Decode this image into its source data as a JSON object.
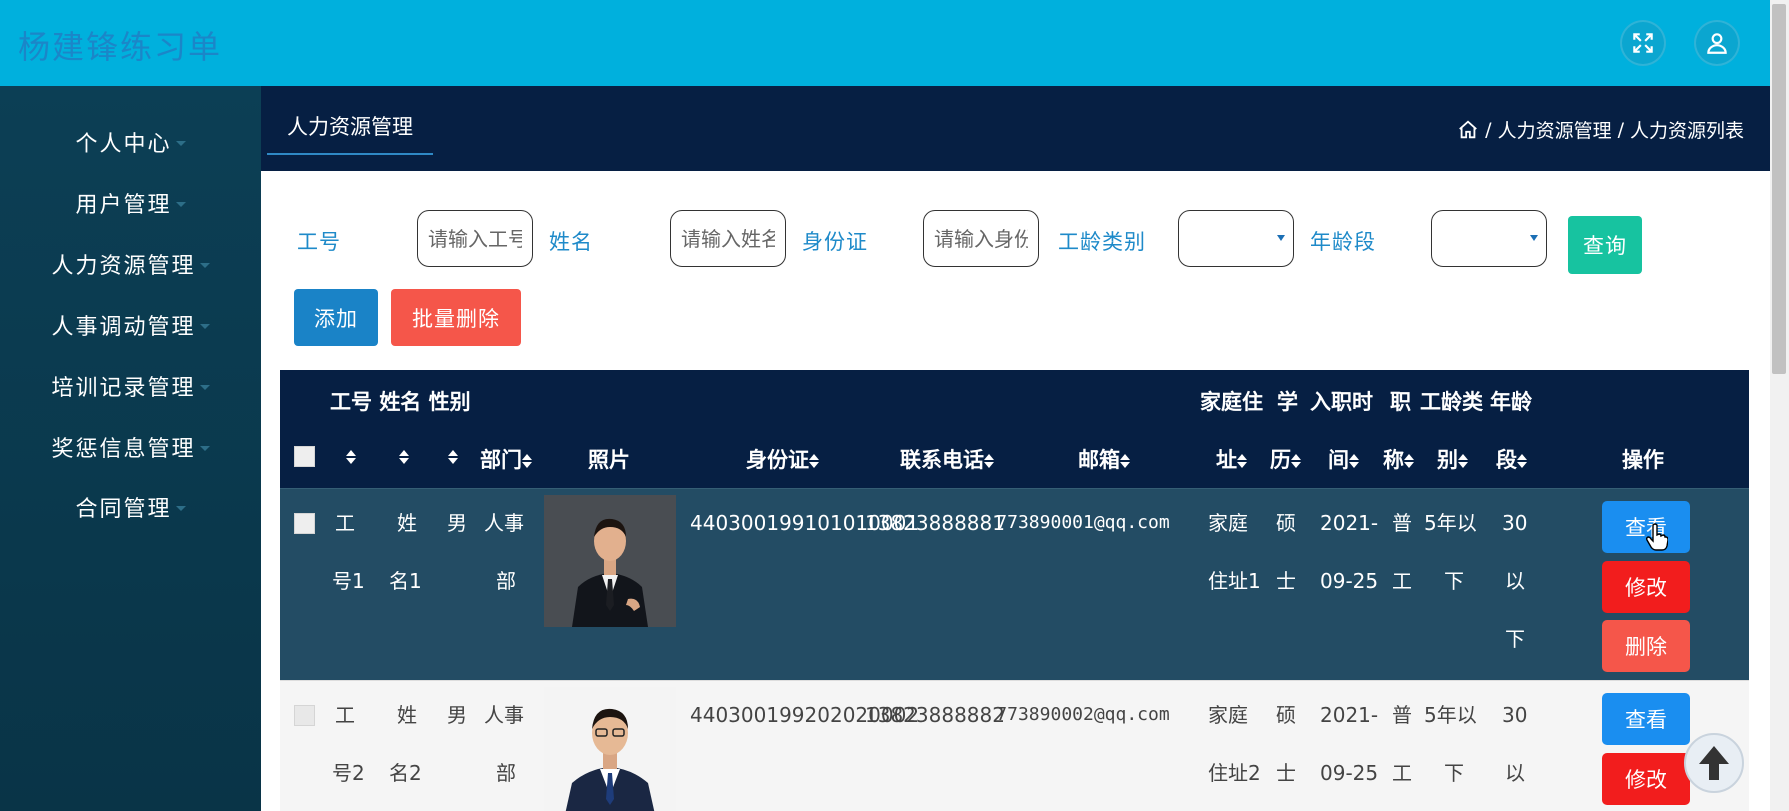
{
  "app": {
    "title": "杨建锋练习单"
  },
  "header": {
    "fullscreen_icon": "expand-arrows-icon",
    "user_icon": "user-icon"
  },
  "sidebar": {
    "items": [
      {
        "label": "个人中心"
      },
      {
        "label": "用户管理"
      },
      {
        "label": "人力资源管理"
      },
      {
        "label": "人事调动管理"
      },
      {
        "label": "培训记录管理"
      },
      {
        "label": "奖惩信息管理"
      },
      {
        "label": "合同管理"
      }
    ]
  },
  "tabs": {
    "active": "人力资源管理"
  },
  "breadcrumb": {
    "home_icon": "home-icon",
    "sep": "/",
    "level1": "人力资源管理",
    "level2": "人力资源列表"
  },
  "filters": {
    "gonghao": {
      "label": "工号",
      "placeholder": "请输入工号"
    },
    "xingming": {
      "label": "姓名",
      "placeholder": "请输入姓名"
    },
    "shenfenzheng": {
      "label": "身份证",
      "placeholder": "请输入身份证"
    },
    "gonglingleibie": {
      "label": "工龄类别",
      "value": ""
    },
    "nianlingduan": {
      "label": "年龄段",
      "value": ""
    },
    "query_label": "查询"
  },
  "toolbar": {
    "add_label": "添加",
    "batch_delete_label": "批量删除"
  },
  "table": {
    "columns": {
      "gonghao": "工号",
      "xingming": "姓名",
      "xingbie": "性别",
      "bumen": "部门",
      "zhaopian": "照片",
      "shenfenzheng": "身份证",
      "lianxidianhua": "联系电话",
      "youxiang": "邮箱",
      "jiating_top": "家庭住",
      "jiating_bottom": "址",
      "xueli_top": "学",
      "xueli_bottom": "历",
      "ruzhi_top": "入职时",
      "ruzhi_bottom": "间",
      "zhicheng_top": "职",
      "zhicheng_bottom": "称",
      "gongling_top": "工龄类",
      "gongling_bottom": "别",
      "nianling_top": "年龄",
      "nianling_bottom": "段",
      "caozuo": "操作"
    },
    "rows": [
      {
        "gonghao": [
          "工",
          "号1"
        ],
        "xingming": [
          "姓",
          "名1"
        ],
        "xingbie": "男",
        "bumen": [
          "人事",
          "部"
        ],
        "shenfenzheng": "440300199101010001",
        "dianhua": "13823888881",
        "youxiang": "773890001@qq.com",
        "dizhi": [
          "家庭",
          "住址1"
        ],
        "xueli": [
          "硕",
          "士"
        ],
        "ruzhi": [
          "2021-",
          "09-25"
        ],
        "zhicheng": [
          "普",
          "工"
        ],
        "gongling": [
          "5年以",
          "下"
        ],
        "nianling": [
          "30",
          "以",
          "下"
        ]
      },
      {
        "gonghao": [
          "工",
          "号2"
        ],
        "xingming": [
          "姓",
          "名2"
        ],
        "xingbie": "男",
        "bumen": [
          "人事",
          "部"
        ],
        "shenfenzheng": "440300199202020002",
        "dianhua": "13823888882",
        "youxiang": "773890002@qq.com",
        "dizhi": [
          "家庭",
          "住址2"
        ],
        "xueli": [
          "硕",
          "士"
        ],
        "ruzhi": [
          "2021-",
          "09-25"
        ],
        "zhicheng": [
          "普",
          "工"
        ],
        "gongling": [
          "5年以",
          "下"
        ],
        "nianling": [
          "30",
          "以"
        ]
      }
    ],
    "actions": {
      "view": "查看",
      "edit": "修改",
      "delete": "删除"
    }
  },
  "colors": {
    "header_bg": "#00b0dd",
    "sidebar_bg": "#0c3f55",
    "nav_bg": "#061f43",
    "query": "#17c3a0",
    "add": "#1a83c7",
    "batch_delete": "#f5564a",
    "view": "#1a8ef0",
    "edit": "#f21d1d",
    "delete": "#f5564a"
  }
}
